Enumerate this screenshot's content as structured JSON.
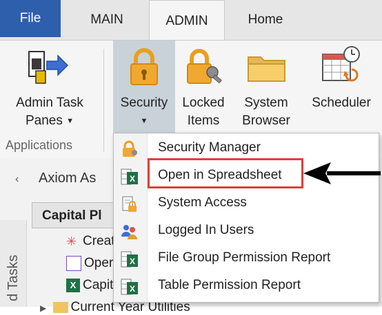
{
  "tabs": {
    "file": "File",
    "main": "MAIN",
    "admin": "ADMIN",
    "home": "Home"
  },
  "ribbon": {
    "admin_task_panes": {
      "line1": "Admin Task",
      "line2": "Panes"
    },
    "security": {
      "line1": "Security"
    },
    "locked_items": {
      "line1": "Locked",
      "line2": "Items"
    },
    "system_browser": {
      "line1": "System",
      "line2": "Browser"
    },
    "scheduler": {
      "line1": "Scheduler"
    },
    "group_label": "Applications"
  },
  "panel": {
    "collapse_glyph": "‹",
    "title": "Axiom As",
    "section": "Capital Pl",
    "vertical_tab": "d Tasks",
    "tree": [
      "Creat",
      "Oper",
      "Capit"
    ],
    "last_row": "Current Year Utilities"
  },
  "menu": {
    "items": [
      {
        "label": "Security Manager",
        "icon": "security-manager-icon"
      },
      {
        "label": "Open in Spreadsheet",
        "icon": "spreadsheet-icon"
      },
      {
        "label": "System Access",
        "icon": "system-access-icon"
      },
      {
        "label": "Logged In Users",
        "icon": "users-icon"
      },
      {
        "label": "File Group Permission Report",
        "icon": "spreadsheet-icon"
      },
      {
        "label": "Table Permission Report",
        "icon": "spreadsheet-icon"
      }
    ]
  },
  "colors": {
    "file_tab": "#2e5fac",
    "security_selected": "#c9d1d9",
    "highlight_box": "#e0403a",
    "excel_green": "#1e7145",
    "lock_orange": "#f0a830"
  }
}
